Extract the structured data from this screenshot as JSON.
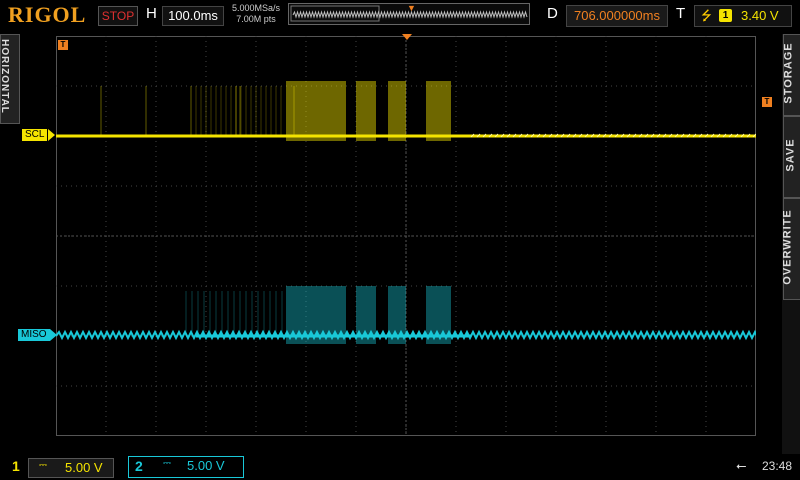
{
  "topbar": {
    "brand": "RIGOL",
    "run_state": "STOP",
    "h_label": "H",
    "timebase": "100.0ms",
    "sample_rate": "5.000MSa/s",
    "memory_depth": "7.00M pts",
    "d_label": "D",
    "delay": "706.000000ms",
    "t_label": "T",
    "trigger_edge_icon": "rising-edge-icon",
    "trigger_source": "1",
    "trigger_level": "3.40 V"
  },
  "side_menu": {
    "horizontal": "HORIZONTAL",
    "storage": "STORAGE",
    "save": "SAVE",
    "overwrite": "OVERWRITE"
  },
  "screen": {
    "trigger_marker": "T",
    "channels": [
      {
        "label": "SCL",
        "color": "#f5e400"
      },
      {
        "label": "MISO",
        "color": "#19c8d8"
      }
    ]
  },
  "bottombar": {
    "ch1": {
      "number": "1",
      "coupling": "⎓",
      "scale": "5.00 V",
      "color": "#f5e400"
    },
    "ch2": {
      "number": "2",
      "coupling": "⎓",
      "scale": "5.00 V",
      "color": "#19c8d8"
    },
    "usb_icon": "usb-icon",
    "time": "23:48"
  }
}
